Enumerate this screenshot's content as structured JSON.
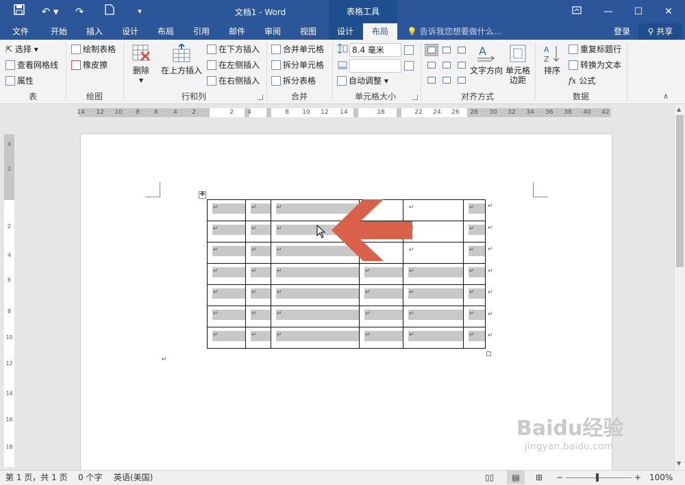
{
  "titlebar": {
    "doc_title": "文档1 - Word",
    "contextual_label": "表格工具"
  },
  "tabs": [
    "文件",
    "开始",
    "插入",
    "设计",
    "布局",
    "引用",
    "邮件",
    "审阅",
    "视图",
    "设计",
    "布局"
  ],
  "active_tab": "布局",
  "tell_me": "告诉我您想要做什么...",
  "login": "登录",
  "share": "共享",
  "ribbon": {
    "table": {
      "select": "选择",
      "gridlines": "查看网格线",
      "properties": "属性",
      "group": "表"
    },
    "draw": {
      "draw_table": "绘制表格",
      "eraser": "橡皮擦",
      "group": "绘图"
    },
    "rows_cols": {
      "delete": "删除",
      "insert_above": "在上方插入",
      "insert_below": "在下方插入",
      "insert_left": "在左侧插入",
      "insert_right": "在右侧插入",
      "group": "行和列"
    },
    "merge": {
      "merge_cells": "合并单元格",
      "split_cells": "拆分单元格",
      "split_table": "拆分表格",
      "group": "合并"
    },
    "cell_size": {
      "height_value": "8.4 毫米",
      "width_value": "",
      "autofit": "自动调整",
      "group": "单元格大小"
    },
    "alignment": {
      "text_direction": "文字方向",
      "cell_margins_line1": "单元格",
      "cell_margins_line2": "边距",
      "group": "对齐方式"
    },
    "data": {
      "sort": "排序",
      "repeat_header": "重复标题行",
      "convert_text": "转换为文本",
      "formula": "公式",
      "group": "数据"
    }
  },
  "ruler_h": [
    "14",
    "12",
    "10",
    "8",
    "6",
    "4",
    "2",
    "2",
    "4",
    "8",
    "10",
    "12",
    "14",
    "18",
    "22",
    "24",
    "26",
    "28",
    "30",
    "32",
    "34",
    "36",
    "38",
    "40",
    "42"
  ],
  "ruler_v": [
    "4",
    "2",
    "2",
    "4",
    "6",
    "8",
    "10",
    "12",
    "14",
    "16",
    "18"
  ],
  "ruler_corner": "L",
  "table_mark": "↵",
  "status": {
    "page": "第 1 页，共 1 页",
    "words": "0 个字",
    "lang": "英语(美国)",
    "zoom": "100%"
  },
  "watermark": {
    "brand": "Baidu经验",
    "url": "jingyan.baidu.com"
  },
  "colors": {
    "title_bar": "#2b579a",
    "arrow": "#d9614a",
    "highlight": "#c8c8c8"
  }
}
